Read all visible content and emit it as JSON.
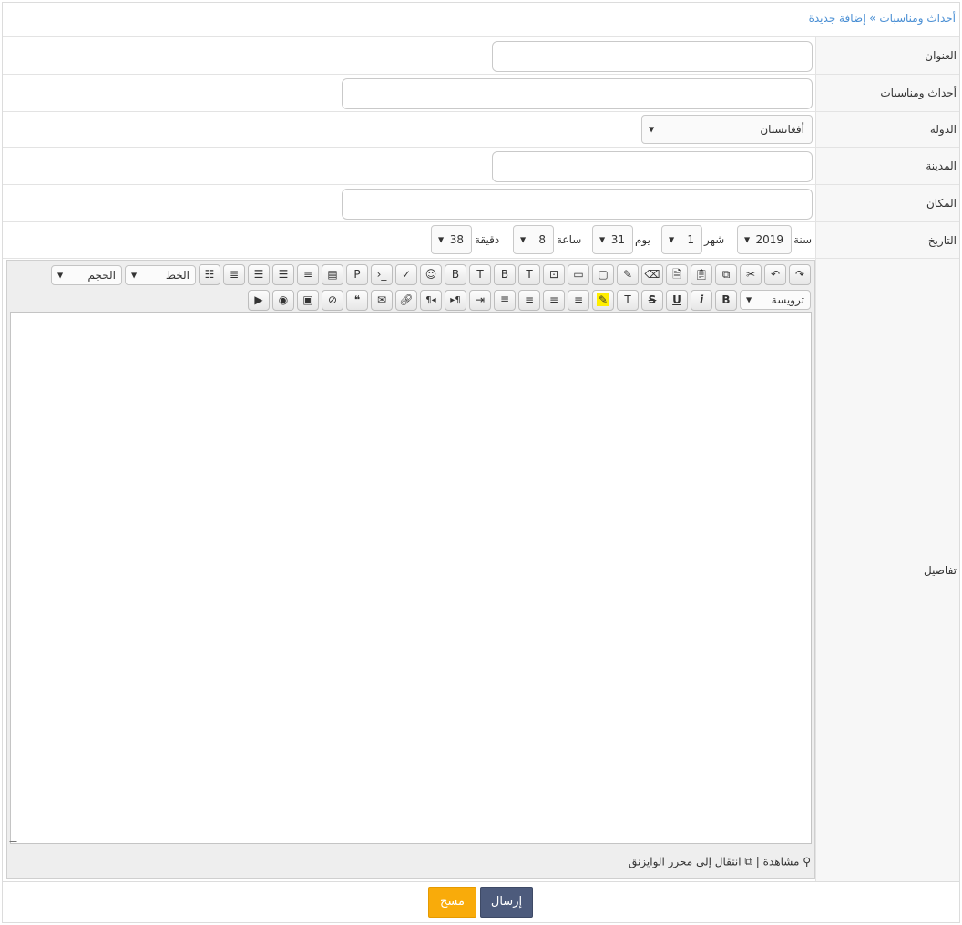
{
  "breadcrumb": "أحداث ومناسبات » إضافة جديدة",
  "fields": {
    "title": {
      "label": "العنوان",
      "value": ""
    },
    "events": {
      "label": "أحداث ومناسبات",
      "value": ""
    },
    "country": {
      "label": "الدولة",
      "value": "أفغانستان"
    },
    "city": {
      "label": "المدينة",
      "value": ""
    },
    "place": {
      "label": "المكان",
      "value": ""
    },
    "date": {
      "label": "التاريخ",
      "year_label": "سنة",
      "year": "2019",
      "month_label": "شهر",
      "month": "1",
      "day_label": "يوم",
      "day": "31",
      "hour_label": "ساعة",
      "hour": "8",
      "minute_label": "دقيقة",
      "minute": "38"
    },
    "details": {
      "label": "تفاصيل"
    }
  },
  "editor": {
    "size_select": "الحجم",
    "font_select": "الخط",
    "heading_select": "ترويسة",
    "buttons": {
      "bold": "B",
      "italic": "i",
      "underline": "U",
      "strike": "S",
      "rtl": "¶◂",
      "ltr": "▸¶"
    },
    "status_preview": "مشاهدة",
    "status_separator": "|",
    "status_switch": "انتقال إلى محرر الوايزنق"
  },
  "actions": {
    "submit": "إرسال",
    "clear": "مسح"
  }
}
